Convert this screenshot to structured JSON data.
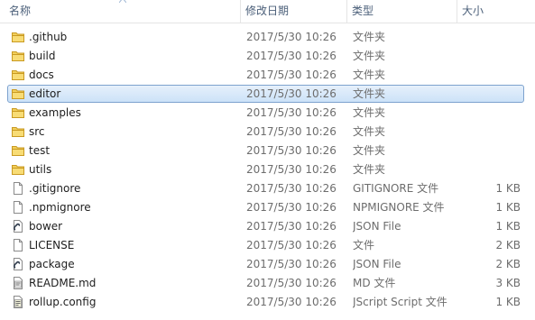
{
  "columns": {
    "name": "名称",
    "date": "修改日期",
    "type": "类型",
    "size": "大小"
  },
  "files": [
    {
      "name": ".github",
      "date": "2017/5/30 10:26",
      "type": "文件夹",
      "size": "",
      "icon": "folder-icon"
    },
    {
      "name": "build",
      "date": "2017/5/30 10:26",
      "type": "文件夹",
      "size": "",
      "icon": "folder-icon"
    },
    {
      "name": "docs",
      "date": "2017/5/30 10:26",
      "type": "文件夹",
      "size": "",
      "icon": "folder-icon"
    },
    {
      "name": "editor",
      "date": "2017/5/30 10:26",
      "type": "文件夹",
      "size": "",
      "icon": "folder-icon",
      "selected": true
    },
    {
      "name": "examples",
      "date": "2017/5/30 10:26",
      "type": "文件夹",
      "size": "",
      "icon": "folder-icon"
    },
    {
      "name": "src",
      "date": "2017/5/30 10:26",
      "type": "文件夹",
      "size": "",
      "icon": "folder-icon"
    },
    {
      "name": "test",
      "date": "2017/5/30 10:26",
      "type": "文件夹",
      "size": "",
      "icon": "folder-icon"
    },
    {
      "name": "utils",
      "date": "2017/5/30 10:26",
      "type": "文件夹",
      "size": "",
      "icon": "folder-icon"
    },
    {
      "name": ".gitignore",
      "date": "2017/5/30 10:26",
      "type": "GITIGNORE 文件",
      "size": "1 KB",
      "icon": "file-icon"
    },
    {
      "name": ".npmignore",
      "date": "2017/5/30 10:26",
      "type": "NPMIGNORE 文件",
      "size": "1 KB",
      "icon": "file-icon"
    },
    {
      "name": "bower",
      "date": "2017/5/30 10:26",
      "type": "JSON File",
      "size": "1 KB",
      "icon": "json-file-icon"
    },
    {
      "name": "LICENSE",
      "date": "2017/5/30 10:26",
      "type": "文件",
      "size": "2 KB",
      "icon": "file-icon"
    },
    {
      "name": "package",
      "date": "2017/5/30 10:26",
      "type": "JSON File",
      "size": "2 KB",
      "icon": "json-file-icon"
    },
    {
      "name": "README.md",
      "date": "2017/5/30 10:26",
      "type": "MD 文件",
      "size": "3 KB",
      "icon": "markdown-file-icon"
    },
    {
      "name": "rollup.config",
      "date": "2017/5/30 10:26",
      "type": "JScript Script 文件",
      "size": "1 KB",
      "icon": "script-file-icon"
    }
  ],
  "colors": {
    "header_text": "#4c607a",
    "selection_border": "#7da2ce",
    "folder": "#e8c14a",
    "detail_text": "#6d6d6d"
  }
}
